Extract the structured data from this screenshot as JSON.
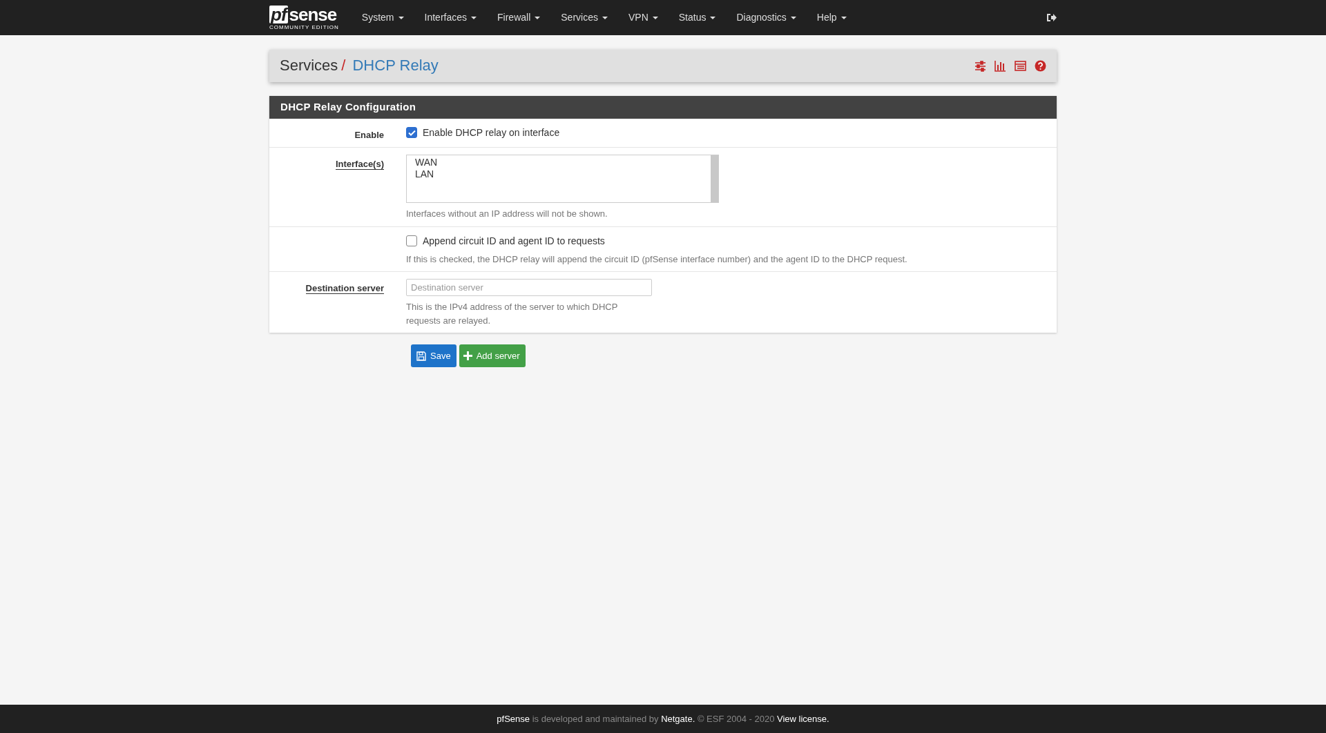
{
  "navbar": {
    "logo": {
      "mark": "pf",
      "word": "sense",
      "edition": "COMMUNITY EDITION"
    },
    "menus": [
      {
        "label": "System"
      },
      {
        "label": "Interfaces"
      },
      {
        "label": "Firewall"
      },
      {
        "label": "Services"
      },
      {
        "label": "VPN"
      },
      {
        "label": "Status"
      },
      {
        "label": "Diagnostics"
      },
      {
        "label": "Help"
      }
    ]
  },
  "breadcrumb": {
    "parent": "Services",
    "separator": "/",
    "current": "DHCP Relay"
  },
  "panel": {
    "title": "DHCP Relay Configuration",
    "rows": [
      {
        "kind": "checkbox",
        "label": "Enable",
        "underlined": false,
        "checkbox_label": "Enable DHCP relay on interface",
        "checked": true
      },
      {
        "kind": "listbox",
        "label": "Interface(s)",
        "underlined": true,
        "options": [
          {
            "label": "WAN",
            "selected": false
          },
          {
            "label": "LAN",
            "selected": false
          }
        ],
        "help": "Interfaces without an IP address will not be shown."
      },
      {
        "kind": "checkbox",
        "checkbox_label": "Append circuit ID and agent ID to requests",
        "checked": false,
        "help": "If this is checked, the DHCP relay will append the circuit ID (pfSense interface number) and the agent ID to the DHCP request."
      },
      {
        "kind": "text",
        "label": "Destination server",
        "underlined": true,
        "placeholder": "Destination server",
        "help": "This is the IPv4 address of the server to which DHCP requests are relayed."
      }
    ]
  },
  "buttons": [
    {
      "kind": "save",
      "label": "Save"
    },
    {
      "kind": "add",
      "label": "Add server"
    }
  ],
  "footer": [
    {
      "kind": "link",
      "text": "pfSense"
    },
    {
      "kind": "text",
      "text": "is developed and maintained by"
    },
    {
      "kind": "link",
      "text": "Netgate."
    },
    {
      "kind": "text",
      "text": "© ESF 2004 - 2020"
    },
    {
      "kind": "link",
      "text": "View license."
    }
  ]
}
